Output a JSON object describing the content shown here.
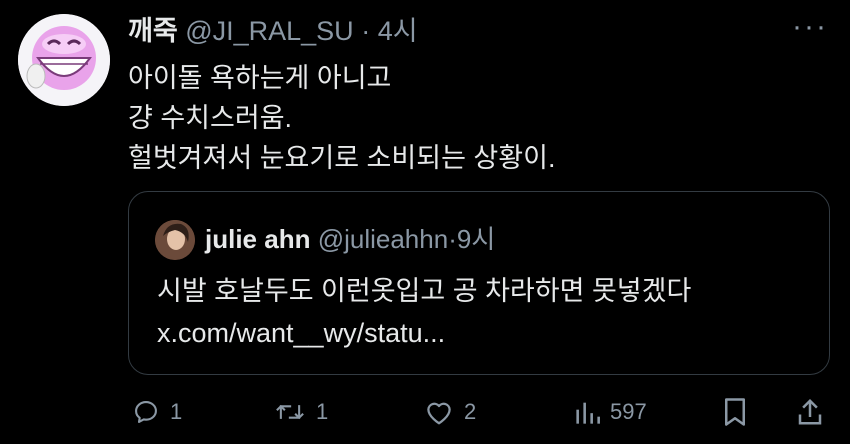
{
  "tweet": {
    "display_name": "깨죽",
    "handle": "@JI_RAL_SU",
    "separator": "·",
    "time": "4시",
    "lines": [
      "아이돌 욕하는게 아니고",
      "걍 수치스러움.",
      "헐벗겨져서 눈요기로 소비되는 상황이."
    ],
    "more_icon": "ellipsis-icon"
  },
  "quote": {
    "display_name": "julie ahn",
    "handle": "@julieahhn",
    "separator": "·",
    "time": "9시",
    "lines": [
      "시발 호날두도 이런옷입고 공 차라하면 못넣겠다",
      "x.com/want__wy/statu..."
    ]
  },
  "actions": {
    "reply_count": "1",
    "retweet_count": "1",
    "like_count": "2",
    "views_count": "597"
  },
  "colors": {
    "background": "#000000",
    "text": "#e7e9ea",
    "muted": "#8b98a5",
    "border": "#333b42"
  }
}
